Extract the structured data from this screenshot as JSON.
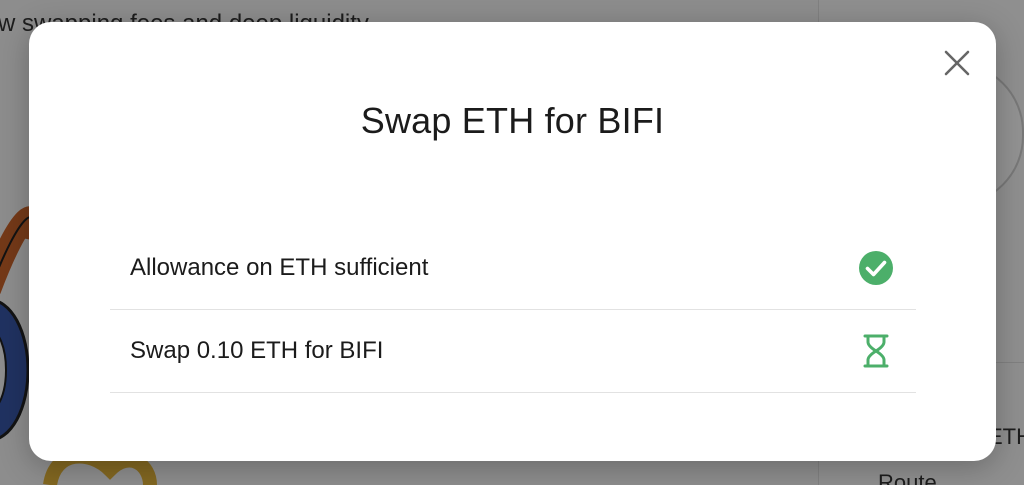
{
  "background": {
    "tagline": "w swapping fees and deep liquidity",
    "side_value_fragment": "ETH",
    "side_section_label": "Route"
  },
  "modal": {
    "title": "Swap ETH for BIFI",
    "close_icon": "close-icon",
    "steps": [
      {
        "label": "Allowance on ETH sufficient",
        "status": "complete",
        "icon": "check-circle-icon"
      },
      {
        "label": "Swap 0.10 ETH for BIFI",
        "status": "pending",
        "icon": "hourglass-icon"
      }
    ]
  },
  "colors": {
    "success": "#4caf6a",
    "pending": "#4caf6a",
    "text": "#1b1b1b",
    "divider": "#e2e2e2",
    "close": "#666666"
  }
}
